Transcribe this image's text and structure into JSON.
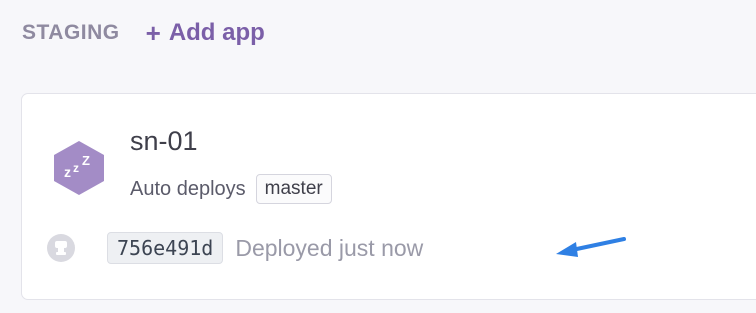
{
  "pipeline": {
    "stage_label": "STAGING",
    "add_app_label": "Add app",
    "add_app_icon": "plus-icon"
  },
  "app_card": {
    "app_name": "sn-01",
    "app_icon": "sleeping-dyno-icon",
    "auto_deploys_label": "Auto deploys",
    "branch": "master",
    "commit": "756e491d",
    "deployed_text": "Deployed just now",
    "deployer_icon": "user-avatar-icon"
  },
  "annotation": {
    "arrow_icon": "arrow-left-icon",
    "arrow_color": "#2f80e4"
  },
  "colors": {
    "accent": "#7b5fa8",
    "icon_purple": "#a38cc6"
  }
}
